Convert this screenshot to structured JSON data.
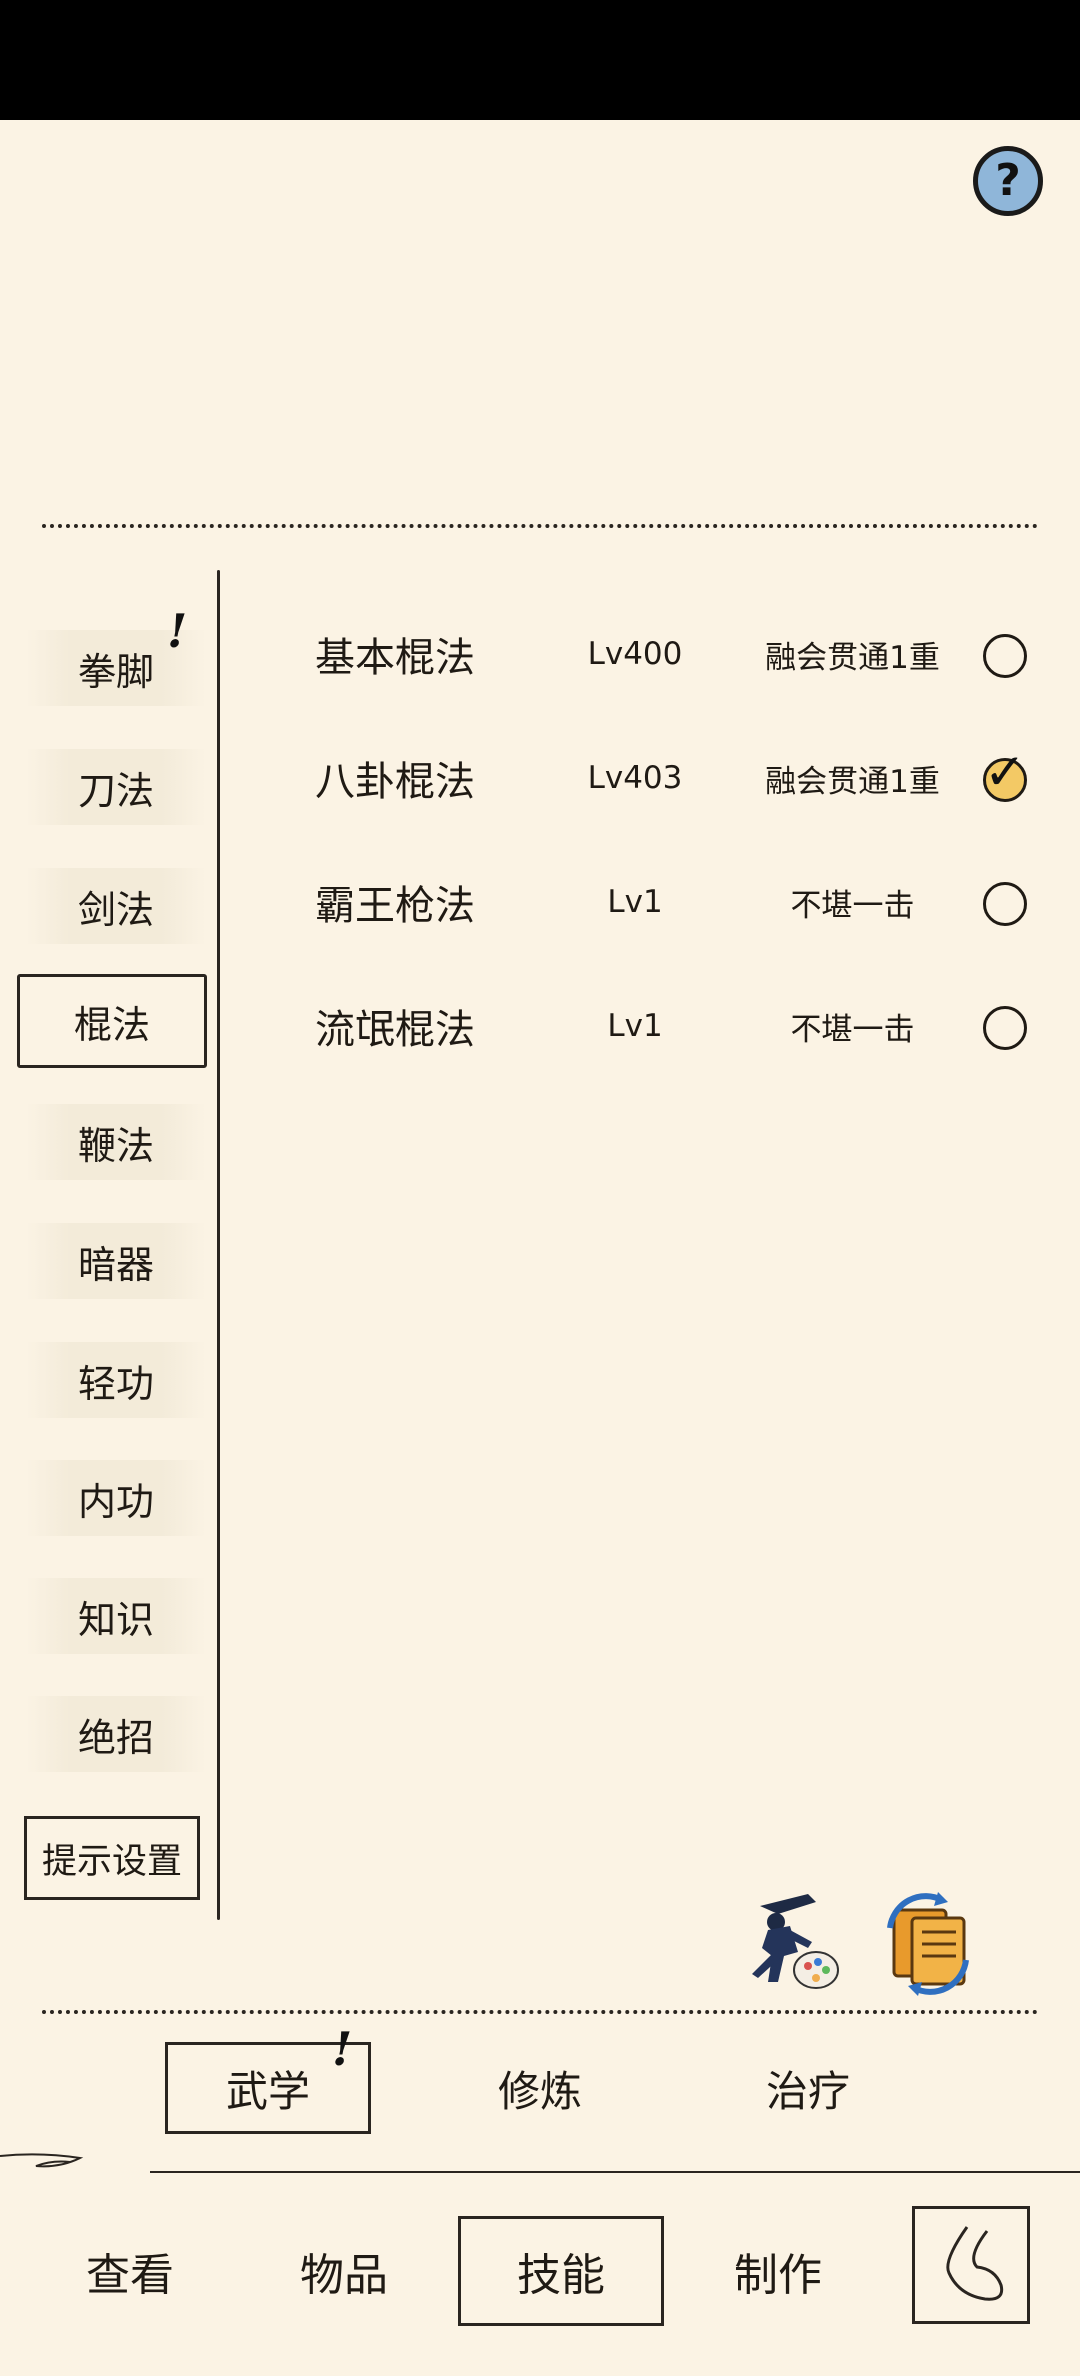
{
  "header": {
    "help_glyph": "?"
  },
  "categories": [
    {
      "label": "拳脚",
      "badge": "!"
    },
    {
      "label": "刀法"
    },
    {
      "label": "剑法"
    },
    {
      "label": "棍法",
      "selected": true
    },
    {
      "label": "鞭法"
    },
    {
      "label": "暗器"
    },
    {
      "label": "轻功"
    },
    {
      "label": "内功"
    },
    {
      "label": "知识"
    },
    {
      "label": "绝招"
    }
  ],
  "hint_settings_label": "提示设置",
  "skills": [
    {
      "name": "基本棍法",
      "level": "Lv400",
      "rank": "融会贯通1重",
      "equipped": false
    },
    {
      "name": "八卦棍法",
      "level": "Lv403",
      "rank": "融会贯通1重",
      "equipped": true
    },
    {
      "name": "霸王枪法",
      "level": "Lv1",
      "rank": "不堪一击",
      "equipped": false
    },
    {
      "name": "流氓棍法",
      "level": "Lv1",
      "rank": "不堪一击",
      "equipped": false
    }
  ],
  "tools": [
    {
      "icon": "martial-artist-palette-icon"
    },
    {
      "icon": "scroll-swap-icon"
    }
  ],
  "sub_tabs": [
    {
      "label": "武学",
      "selected": true,
      "badge": "!"
    },
    {
      "label": "修炼"
    },
    {
      "label": "治疗"
    }
  ],
  "bottom_nav": [
    {
      "label": "查看"
    },
    {
      "label": "物品"
    },
    {
      "label": "技能",
      "selected": true
    },
    {
      "label": "制作"
    }
  ],
  "back_icon": "back-swirl-icon",
  "colors": {
    "background": "#fbf3e4",
    "ink": "#1f1a14",
    "help_blue": "#8fb6d9",
    "check_gold": "#f3c965"
  }
}
